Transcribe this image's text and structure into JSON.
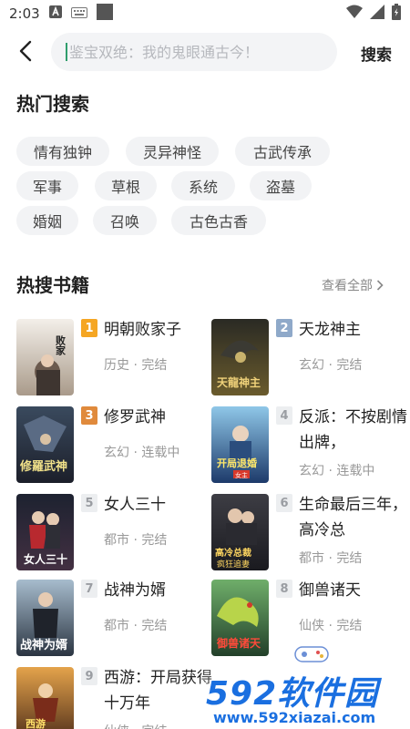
{
  "status": {
    "time": "2:03"
  },
  "search": {
    "placeholder": "鉴宝双绝：我的鬼眼通古今！",
    "button_label": "搜索"
  },
  "hot_search": {
    "title": "热门搜索",
    "tags": [
      "情有独钟",
      "灵异神怪",
      "古武传承",
      "军事",
      "草根",
      "系统",
      "盗墓",
      "婚姻",
      "召唤",
      "古色古香"
    ]
  },
  "hot_books": {
    "title": "热搜书籍",
    "view_all_label": "查看全部",
    "books": [
      {
        "rank": "1",
        "title": "明朝败家子",
        "meta": "历史 · 完结",
        "cover_text": "明朝败家子"
      },
      {
        "rank": "2",
        "title": "天龙神主",
        "meta": "玄幻 · 完结",
        "cover_text": "天龍神主"
      },
      {
        "rank": "3",
        "title": "修罗武神",
        "meta": "玄幻 · 连载中",
        "cover_text": "修罗武神"
      },
      {
        "rank": "4",
        "title": "反派：不按剧情出牌，",
        "meta": "玄幻 · 连载中",
        "cover_text": "开局退婚女主"
      },
      {
        "rank": "5",
        "title": "女人三十",
        "meta": "都市 · 完结",
        "cover_text": "女人三十"
      },
      {
        "rank": "6",
        "title": "生命最后三年，高冷总",
        "meta": "都市 · 完结",
        "cover_text": "高冷总裁"
      },
      {
        "rank": "7",
        "title": "战神为婿",
        "meta": "都市 · 完结",
        "cover_text": "战神为婿"
      },
      {
        "rank": "8",
        "title": "御兽诸天",
        "meta": "仙侠 · 完结",
        "cover_text": "御兽诸天"
      },
      {
        "rank": "9",
        "title": "西游：开局获得十万年",
        "meta": "仙侠 · 完结",
        "cover_text": "西游"
      }
    ]
  },
  "watermark": {
    "main": "592软件园",
    "sub": "www.592xiazai.com"
  },
  "colors": {
    "accent": "#2f9e6c",
    "rank_gold": "#f5a623",
    "rank_silver": "#8fa9c9",
    "rank_bronze": "#e08a3c",
    "watermark": "#1a6fe0"
  }
}
